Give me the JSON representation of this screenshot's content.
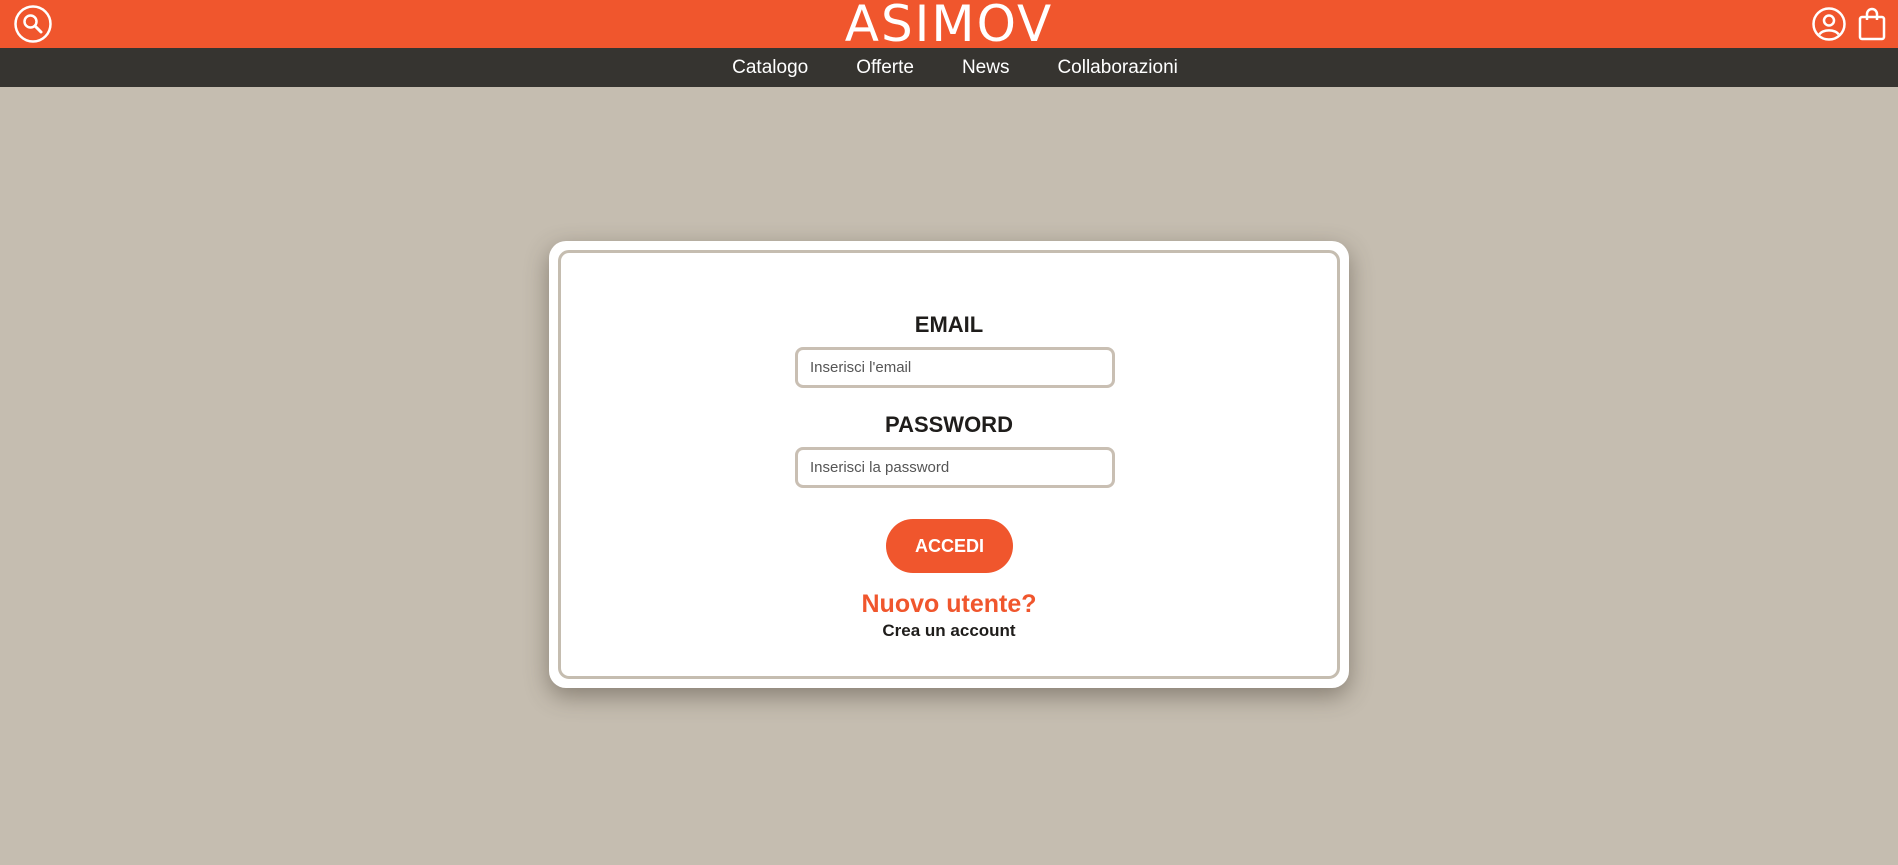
{
  "header": {
    "logo_text": "ASIMOV",
    "brand_color": "#f0562d",
    "search_icon": "search-icon",
    "account_icon": "user-circle-icon",
    "cart_icon": "shopping-bag-icon"
  },
  "nav": {
    "background": "#363430",
    "items": [
      {
        "label": "Catalogo"
      },
      {
        "label": "Offerte"
      },
      {
        "label": "News"
      },
      {
        "label": "Collaborazioni"
      }
    ]
  },
  "login": {
    "email_label": "EMAIL",
    "email_placeholder": "Inserisci l'email",
    "email_value": "",
    "password_label": "PASSWORD",
    "password_placeholder": "Inserisci la password",
    "password_value": "",
    "submit_label": "ACCEDI",
    "new_user_text": "Nuovo utente?",
    "create_account_link": "Crea un account"
  },
  "theme": {
    "page_background": "#c5bdb0",
    "accent": "#f0562d",
    "input_border": "#c9bfb3"
  }
}
